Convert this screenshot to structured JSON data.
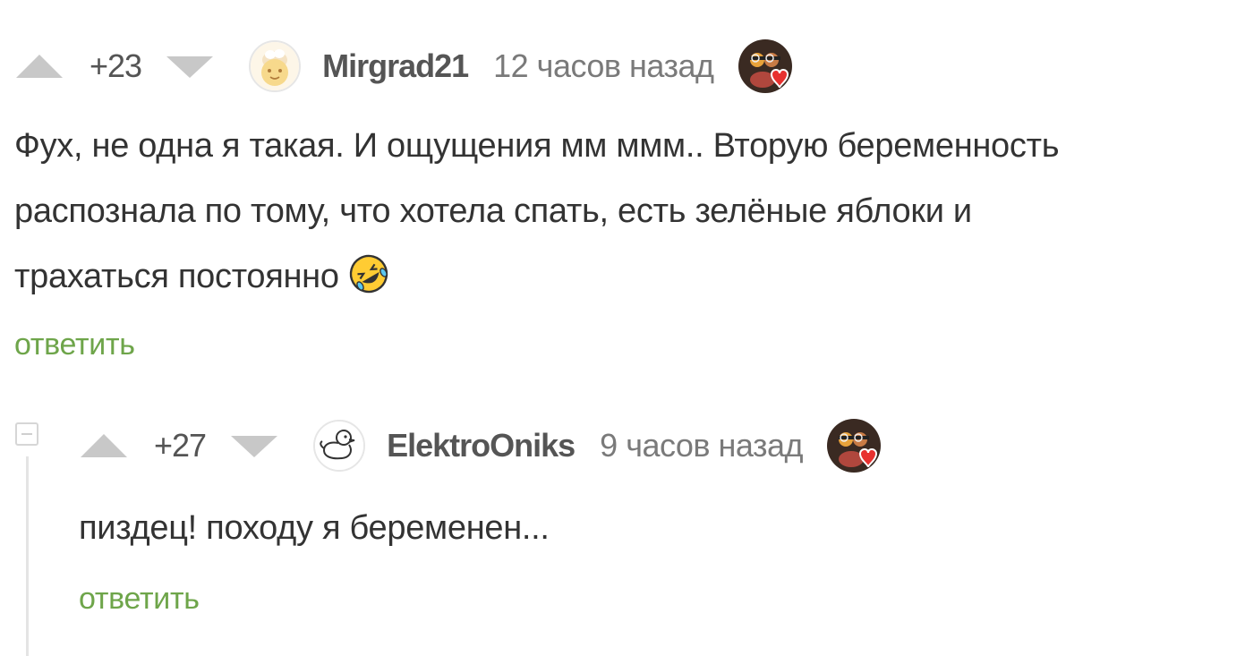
{
  "comments": [
    {
      "rating": "+23",
      "username": "Mirgrad21",
      "time": "12 часов назад",
      "text_lines": [
        "Фух, не одна я такая. И ощущения мм ммм.. Вторую беременность",
        "распознала по тому, что хотела спать, есть зелёные яблоки и",
        "трахаться постоянно"
      ],
      "emoji": "rolling-on-floor-laughing-emoji",
      "reply_label": "ответить",
      "avatar_icon": "bun-face-avatar-icon",
      "badge_icon": "heart-badge-icon"
    },
    {
      "rating": "+27",
      "username": "ElektroOniks",
      "time": "9 часов назад",
      "text_lines": [
        "пиздец! походу я беременен..."
      ],
      "reply_label": "ответить",
      "avatar_icon": "duck-avatar-icon",
      "badge_icon": "heart-badge-icon"
    }
  ],
  "colors": {
    "reply_link": "#6ea54a",
    "vote_arrow": "#c8c8c8",
    "thread_line": "#e4e4e4"
  }
}
